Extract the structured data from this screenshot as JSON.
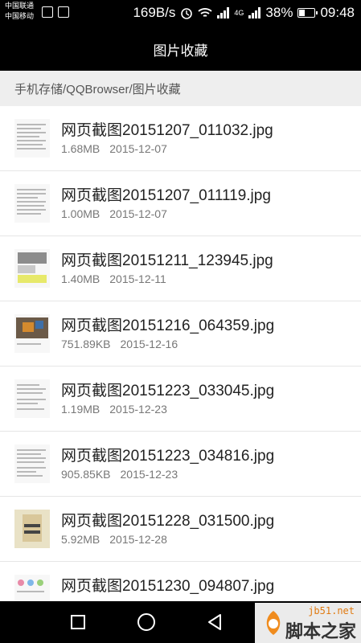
{
  "status_bar": {
    "carrier_1": "中国联通",
    "carrier_2": "中国移动",
    "speed": "169B/s",
    "network": "4G",
    "battery": "38%",
    "battery_level": 0.38,
    "time": "09:48",
    "icons": [
      "image-icon",
      "briefcase-icon",
      "alarm-icon",
      "wifi-icon",
      "signal-icon",
      "battery-icon"
    ]
  },
  "header": {
    "title": "图片收藏"
  },
  "path": {
    "text": "手机存储/QQBrowser/图片收藏"
  },
  "files": [
    {
      "name": "网页截图20151207_011032.jpg",
      "size": "1.68MB",
      "date": "2015-12-07"
    },
    {
      "name": "网页截图20151207_011119.jpg",
      "size": "1.00MB",
      "date": "2015-12-07"
    },
    {
      "name": "网页截图20151211_123945.jpg",
      "size": "1.40MB",
      "date": "2015-12-11"
    },
    {
      "name": "网页截图20151216_064359.jpg",
      "size": "751.89KB",
      "date": "2015-12-16"
    },
    {
      "name": "网页截图20151223_033045.jpg",
      "size": "1.19MB",
      "date": "2015-12-23"
    },
    {
      "name": "网页截图20151223_034816.jpg",
      "size": "905.85KB",
      "date": "2015-12-23"
    },
    {
      "name": "网页截图20151228_031500.jpg",
      "size": "5.92MB",
      "date": "2015-12-28"
    },
    {
      "name": "网页截图20151230_094807.jpg",
      "size": "",
      "date": ""
    }
  ],
  "nav": {
    "icons": [
      "recent-apps-icon",
      "home-icon",
      "back-icon"
    ]
  },
  "watermark": {
    "url": "jb51.net",
    "text": "脚本之家"
  }
}
